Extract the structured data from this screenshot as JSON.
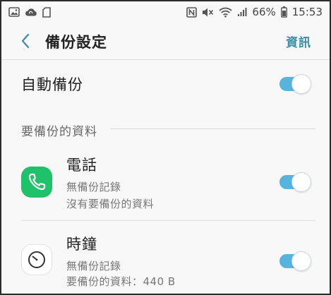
{
  "status_bar": {
    "left_icons": [
      "image-icon",
      "cloud-sync-icon",
      "sd-card-icon"
    ],
    "right_icons": [
      "nfc-icon",
      "mute-icon",
      "wifi-icon",
      "signal-icon"
    ],
    "battery": "66%",
    "time": "15:53"
  },
  "app_bar": {
    "title": "備份設定",
    "info_label": "資訊"
  },
  "auto_backup": {
    "label": "自動備份",
    "enabled": true
  },
  "section": {
    "header": "要備份的資料"
  },
  "items": [
    {
      "title": "電話",
      "line1": "無備份記錄",
      "line2": "沒有要備份的資料",
      "icon": "phone-icon",
      "enabled": true
    },
    {
      "title": "時鐘",
      "line1": "無備份記錄",
      "line2": "要備份的資料：440 B",
      "icon": "clock-icon",
      "enabled": true
    }
  ],
  "colors": {
    "accent": "#3a8fa8",
    "toggle_on": "#56b4df",
    "phone_icon_bg": "#1fc26a"
  }
}
